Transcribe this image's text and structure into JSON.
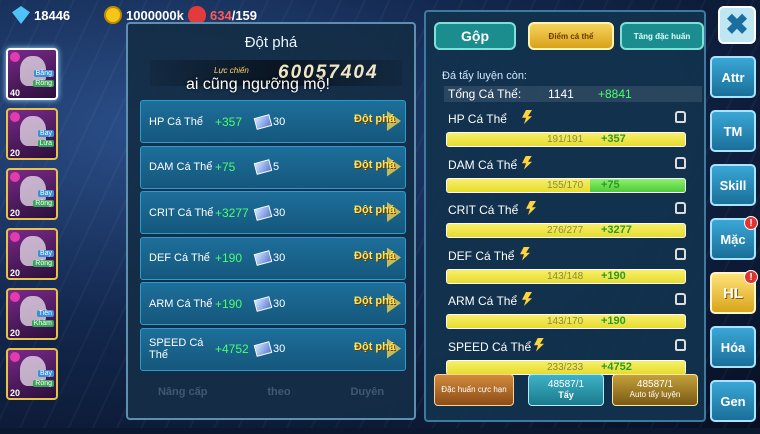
{
  "resources": {
    "gems": "18446",
    "gold": "1000000k",
    "stamina": "634",
    "stamina_max": "/159"
  },
  "roster": [
    {
      "level": "40",
      "tag1": "Băng",
      "tag2": "Rồng",
      "selected": true
    },
    {
      "level": "20",
      "tag1": "Bay",
      "tag2": "Lửa",
      "selected": false
    },
    {
      "level": "20",
      "tag1": "Bay",
      "tag2": "Rồng",
      "selected": false
    },
    {
      "level": "20",
      "tag1": "Bay",
      "tag2": "Rồng",
      "selected": false
    },
    {
      "level": "20",
      "tag1": "Tiên",
      "tag2": "Khám",
      "selected": false
    },
    {
      "level": "20",
      "tag1": "Bay",
      "tag2": "Rồng",
      "selected": false
    }
  ],
  "left_panel": {
    "title": "Đột phá",
    "power_label": "Lực chiến",
    "power_value": "60057404",
    "caption": "ai cũng ngưỡng mộ!",
    "rows": [
      {
        "name": "HP Cá Thể",
        "plus": "+357",
        "cost": "30",
        "button": "Đột phá"
      },
      {
        "name": "DAM Cá Thể",
        "plus": "+75",
        "cost": "5",
        "button": "Đột phá"
      },
      {
        "name": "CRIT Cá Thể",
        "plus": "+3277",
        "cost": "30",
        "button": "Đột phá"
      },
      {
        "name": "DEF Cá Thể",
        "plus": "+190",
        "cost": "30",
        "button": "Đột phá"
      },
      {
        "name": "ARM Cá Thể",
        "plus": "+190",
        "cost": "30",
        "button": "Đột phá"
      },
      {
        "name": "SPEED Cá Thể",
        "plus": "+4752",
        "cost": "30",
        "button": "Đột phá"
      }
    ],
    "bottom_tabs": [
      "Nâng cấp",
      "theo",
      "Duyên"
    ]
  },
  "right_panel": {
    "tabs": {
      "gop": "Gộp",
      "diem": "Điểm cá thể",
      "tang": "Tăng đặc huấn"
    },
    "remain_label": "Đá tẩy luyện còn:",
    "total_label": "Tổng Cá Thể:",
    "total_value": "1141",
    "total_plus": "+8841",
    "stats": [
      {
        "name": "HP Cá Thể",
        "bar_text": "191/191",
        "bar_plus": "+357",
        "fill": 1.0,
        "extra": 0
      },
      {
        "name": "DAM Cá Thể",
        "bar_text": "155/170",
        "bar_plus": "+75",
        "fill": 0.6,
        "extra": 0.4
      },
      {
        "name": "CRIT Cá Thể",
        "bar_text": "276/277",
        "bar_plus": "+3277",
        "fill": 1.0,
        "extra": 0
      },
      {
        "name": "DEF Cá Thể",
        "bar_text": "143/148",
        "bar_plus": "+190",
        "fill": 1.0,
        "extra": 0
      },
      {
        "name": "ARM Cá Thể",
        "bar_text": "143/170",
        "bar_plus": "+190",
        "fill": 1.0,
        "extra": 0
      },
      {
        "name": "SPEED Cá Thể",
        "bar_text": "233/233",
        "bar_plus": "+4752",
        "fill": 1.0,
        "extra": 0
      }
    ],
    "buttons": {
      "dac_huan": "Đặc huấn cực hạn",
      "tay_count": "48587/1",
      "tay": "Tẩy",
      "auto_count": "48587/1",
      "auto": "Auto tẩy luyện"
    }
  },
  "side_menu": {
    "close": "✖",
    "items": [
      {
        "label": "Attr",
        "badge": ""
      },
      {
        "label": "TM",
        "badge": ""
      },
      {
        "label": "Skill",
        "badge": ""
      },
      {
        "label": "Mặc",
        "badge": "!"
      },
      {
        "label": "HL",
        "badge": "!"
      },
      {
        "label": "Hóa",
        "badge": ""
      },
      {
        "label": "Gen",
        "badge": ""
      }
    ]
  }
}
